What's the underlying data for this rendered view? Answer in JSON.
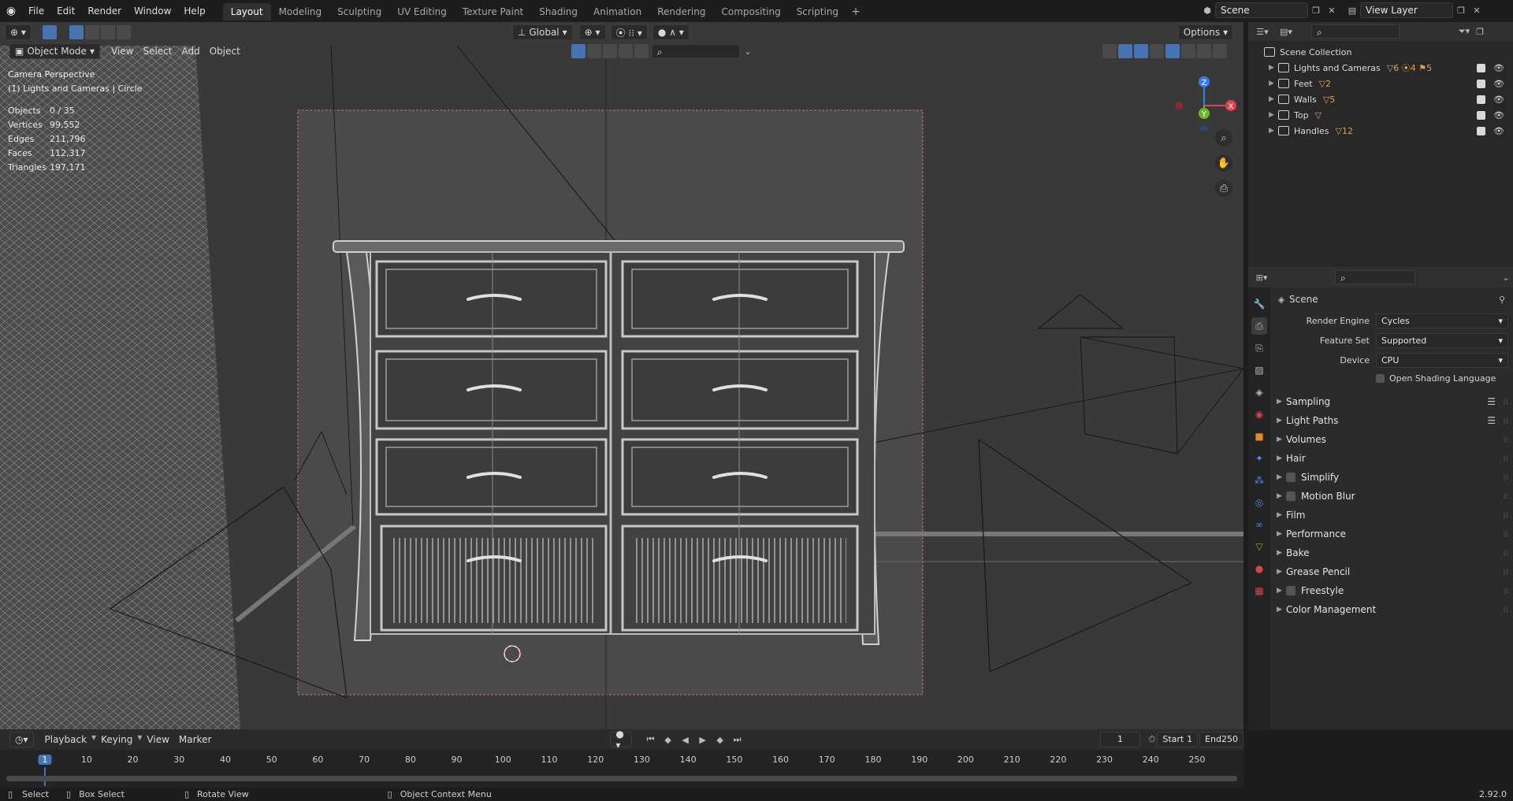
{
  "menu": [
    "File",
    "Edit",
    "Render",
    "Window",
    "Help"
  ],
  "workspaces": [
    "Layout",
    "Modeling",
    "Sculpting",
    "UV Editing",
    "Texture Paint",
    "Shading",
    "Animation",
    "Rendering",
    "Compositing",
    "Scripting"
  ],
  "active_workspace": "Layout",
  "plus": "+",
  "scene_field": "Scene",
  "view_layer_field": "View Layer",
  "viewport": {
    "mode": "Object Mode",
    "menus": [
      "View",
      "Select",
      "Add",
      "Object"
    ],
    "transform": "Global",
    "options": "Options",
    "overlay_title": "Camera Perspective",
    "overlay_sub": "(1) Lights and Cameras | Circle",
    "stats": [
      {
        "k": "Objects",
        "v": "0 / 35"
      },
      {
        "k": "Vertices",
        "v": "99,552"
      },
      {
        "k": "Edges",
        "v": "211,796"
      },
      {
        "k": "Faces",
        "v": "112,317"
      },
      {
        "k": "Triangles",
        "v": "197,171"
      }
    ],
    "axes": {
      "x": "X",
      "y": "Y",
      "z": "Z"
    }
  },
  "outliner": {
    "root": "Scene Collection",
    "rows": [
      {
        "name": "Lights and Cameras",
        "badge": "▽6 ⦿4 ⚑5"
      },
      {
        "name": "Feet",
        "badge": "▽2"
      },
      {
        "name": "Walls",
        "badge": "▽5"
      },
      {
        "name": "Top",
        "badge": "▽"
      },
      {
        "name": "Handles",
        "badge": "▽12"
      }
    ]
  },
  "properties": {
    "title": "Scene",
    "render_engine_label": "Render Engine",
    "render_engine": "Cycles",
    "feature_set_label": "Feature Set",
    "feature_set": "Supported",
    "device_label": "Device",
    "device": "CPU",
    "osl": "Open Shading Language",
    "panels": [
      {
        "name": "Sampling",
        "cb": false,
        "list": true
      },
      {
        "name": "Light Paths",
        "cb": false,
        "list": true
      },
      {
        "name": "Volumes",
        "cb": false,
        "list": false
      },
      {
        "name": "Hair",
        "cb": false,
        "list": false
      },
      {
        "name": "Simplify",
        "cb": true,
        "list": false
      },
      {
        "name": "Motion Blur",
        "cb": true,
        "list": false
      },
      {
        "name": "Film",
        "cb": false,
        "list": false
      },
      {
        "name": "Performance",
        "cb": false,
        "list": false
      },
      {
        "name": "Bake",
        "cb": false,
        "list": false
      },
      {
        "name": "Grease Pencil",
        "cb": false,
        "list": false
      },
      {
        "name": "Freestyle",
        "cb": true,
        "list": false
      },
      {
        "name": "Color Management",
        "cb": false,
        "list": false
      }
    ]
  },
  "timeline": {
    "menus": [
      "Playback",
      "Keying",
      "View",
      "Marker"
    ],
    "current_frame": "1",
    "start_label": "Start",
    "start": "1",
    "end_label": "End",
    "end": "250",
    "ticks": [
      "1",
      "10",
      "20",
      "30",
      "40",
      "50",
      "60",
      "70",
      "80",
      "90",
      "100",
      "110",
      "120",
      "130",
      "140",
      "150",
      "160",
      "170",
      "180",
      "190",
      "200",
      "210",
      "220",
      "230",
      "240",
      "250"
    ]
  },
  "status": {
    "select": "Select",
    "box_select": "Box Select",
    "rotate": "Rotate View",
    "context": "Object Context Menu",
    "version": "2.92.0"
  }
}
